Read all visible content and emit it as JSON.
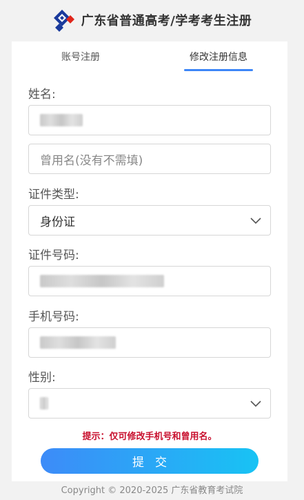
{
  "header": {
    "title": "广东省普通高考/学考考生注册"
  },
  "tabs": [
    {
      "label": "账号注册",
      "active": false
    },
    {
      "label": "修改注册信息",
      "active": true
    }
  ],
  "form": {
    "name": {
      "label": "姓名:",
      "value": ""
    },
    "former_name": {
      "placeholder": "曾用名(没有不需填)",
      "value": ""
    },
    "id_type": {
      "label": "证件类型:",
      "selected": "身份证"
    },
    "id_number": {
      "label": "证件号码:",
      "value": ""
    },
    "phone": {
      "label": "手机号码:",
      "value": ""
    },
    "gender": {
      "label": "性别:",
      "selected": ""
    }
  },
  "hint": "提示：仅可修改手机号和曾用名。",
  "submit_label": "提交",
  "footer": "Copyright © 2020-2025 广东省教育考试院",
  "colors": {
    "accent": "#3d86f7",
    "hint": "#c8102e",
    "button_start": "#3d8bf8",
    "button_end": "#18c3f4"
  },
  "icons": {
    "logo": "diamond-logo-icon",
    "select_arrow": "chevron-down-icon"
  }
}
